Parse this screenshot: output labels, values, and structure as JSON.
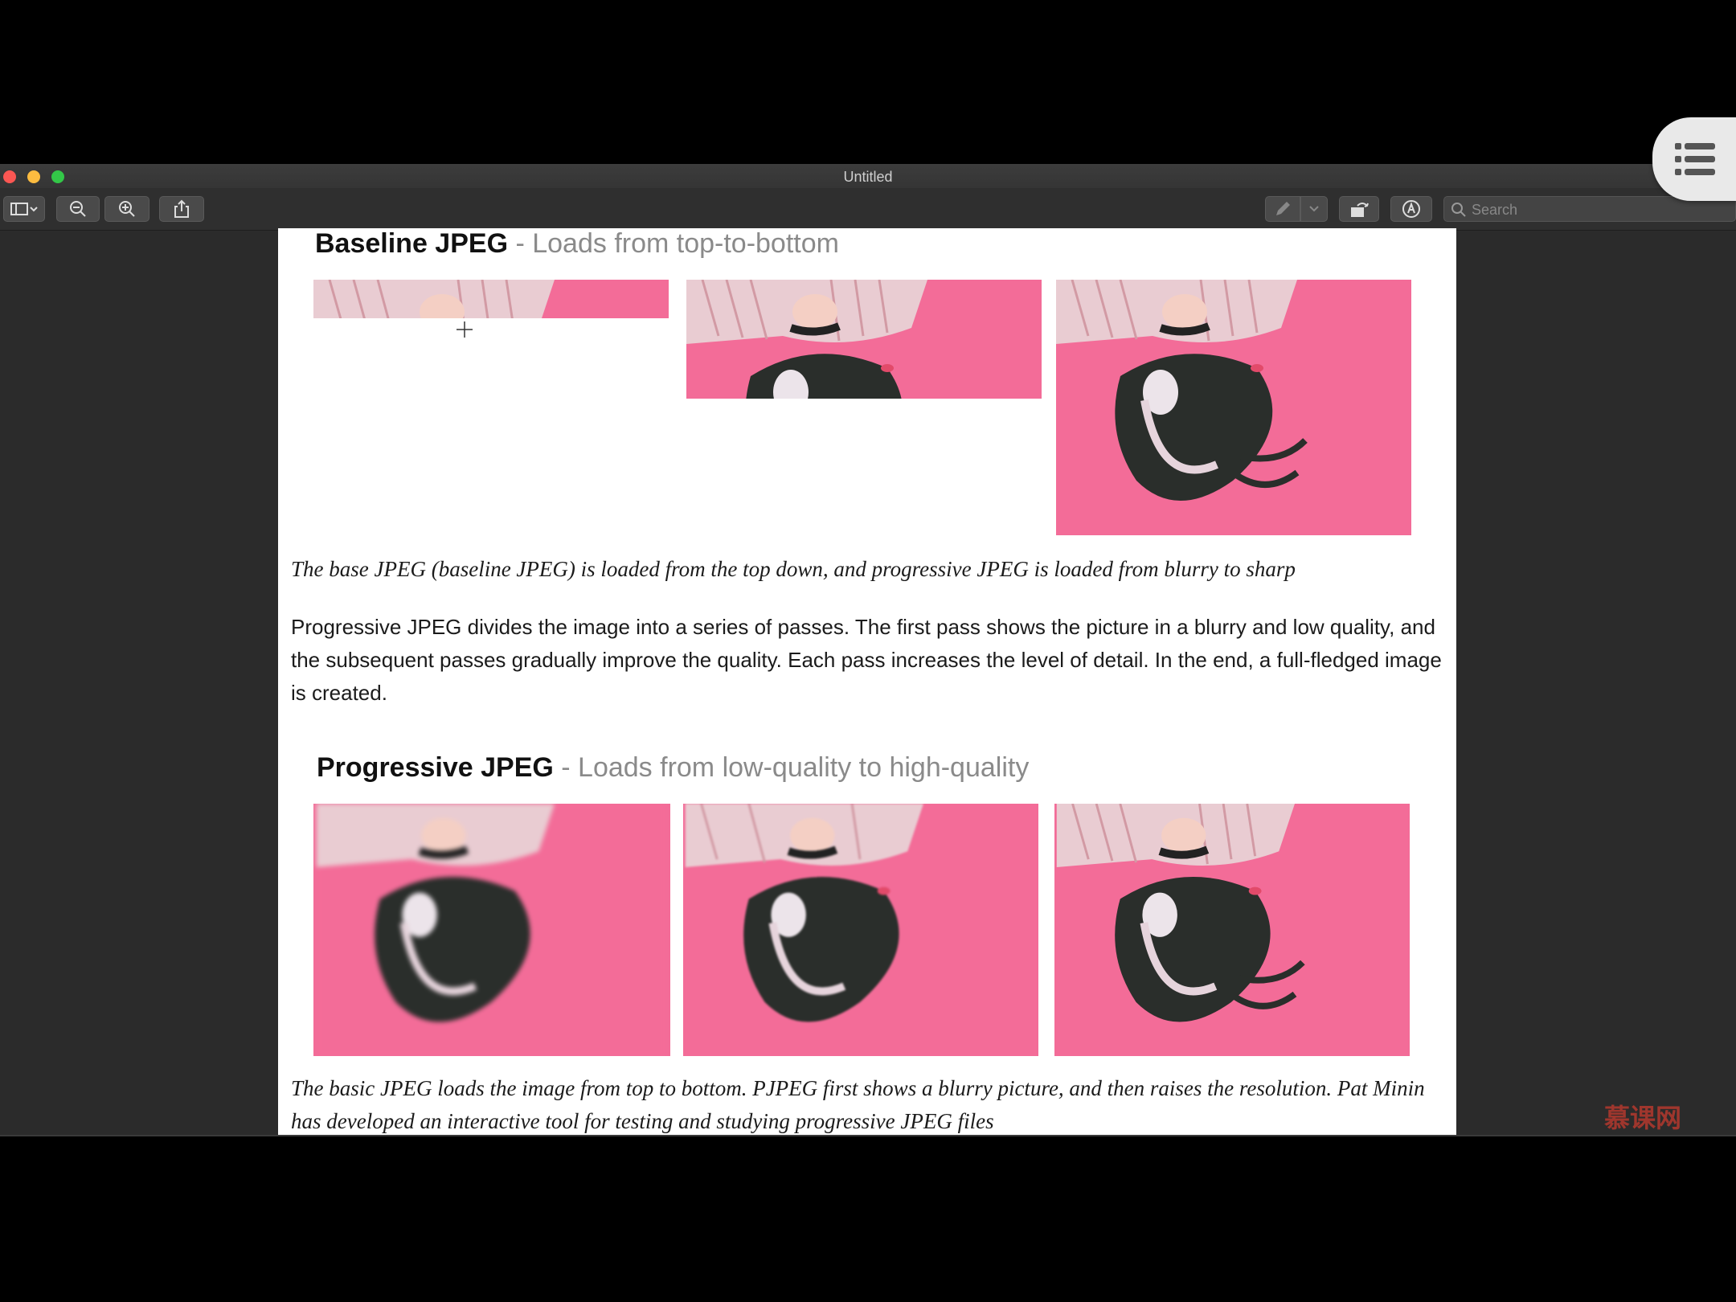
{
  "window": {
    "title": "Untitled"
  },
  "toolbar": {
    "search_placeholder": "Search"
  },
  "document": {
    "baseline": {
      "title": "Baseline JPEG",
      "subtitle": " - Loads from top-to-bottom"
    },
    "caption_1": "The base JPEG (baseline JPEG) is loaded from the top down, and progressive JPEG is loaded from blurry to sharp",
    "paragraph": "Progressive JPEG divides the image into a series of passes. The first pass shows the picture in a blurry and low quality, and the subsequent passes gradually improve the quality. Each pass increases the level of detail. In the end, a full-fledged image is created.",
    "progressive": {
      "title": "Progressive JPEG",
      "subtitle": " - Loads from low-quality to high-quality"
    },
    "caption_2": "The basic JPEG loads the image from top to bottom. PJPEG first shows a blurry picture, and then raises the resolution. Pat Minin has developed an interactive tool for testing and studying progressive JPEG files"
  },
  "watermark": "慕课网",
  "colors": {
    "photo_background": "#f36c98",
    "accent_close": "#fc5753",
    "accent_min": "#fdbc40",
    "accent_max": "#33c748"
  }
}
